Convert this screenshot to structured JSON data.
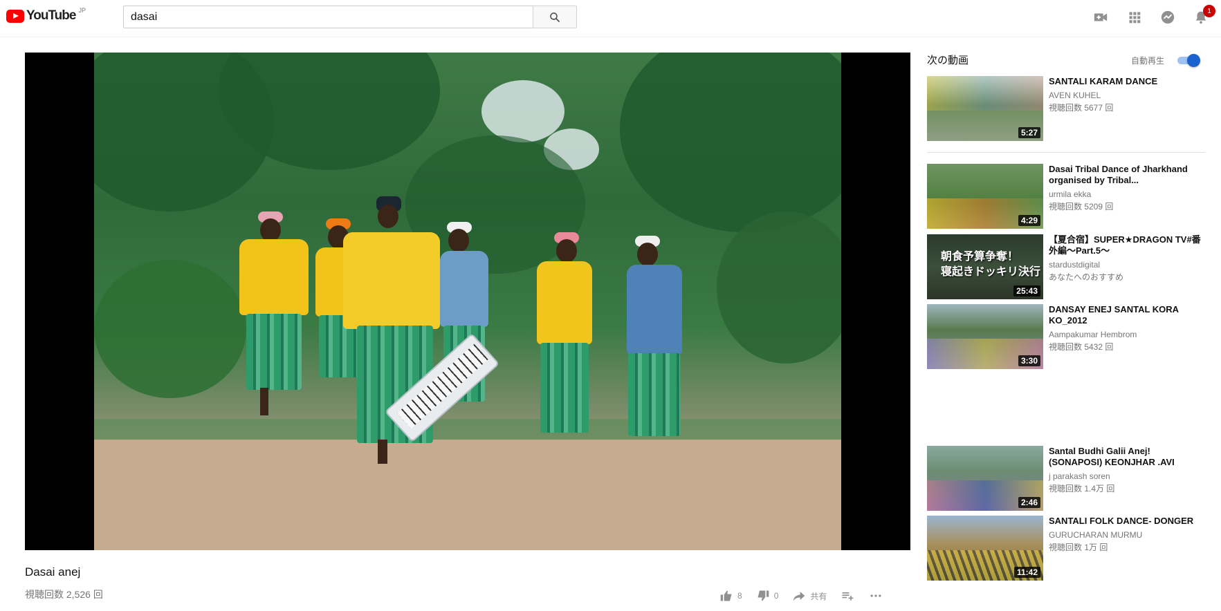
{
  "header": {
    "logo_text": "YouTube",
    "logo_region": "JP",
    "search_value": "dasai",
    "notification_count": "1",
    "icons": [
      "upload-video-icon",
      "apps-grid-icon",
      "messages-icon",
      "notifications-bell-icon"
    ]
  },
  "video": {
    "title": "Dasai anej",
    "view_count": "視聴回数 2,526 回",
    "likes": "8",
    "dislikes": "0",
    "share_label": "共有"
  },
  "sidebar": {
    "up_next_title": "次の動画",
    "autoplay_label": "自動再生",
    "autoplay_on": true,
    "items": [
      {
        "title": "SANTALI KARAM DANCE",
        "channel": "AVEN KUHEL",
        "views": "視聴回数 5677 回",
        "duration": "5:27"
      },
      {
        "title": "Dasai Tribal Dance of Jharkhand organised by Tribal...",
        "channel": "urmila ekka",
        "views": "視聴回数 5209 回",
        "duration": "4:29"
      },
      {
        "title": "【夏合宿】SUPER★DRAGON TV#番外編～Part.5～",
        "channel": "stardustdigital",
        "views": "あなたへのおすすめ",
        "duration": "25:43",
        "thumb_text_1": "朝食予算争奪！",
        "thumb_text_2": "寝起きドッキリ決行"
      },
      {
        "title": "DANSAY ENEJ SANTAL KORA KO_2012",
        "channel": "Aampakumar Hembrom",
        "views": "視聴回数 5432 回",
        "duration": "3:30"
      },
      {
        "title": "Santal Budhi Galii Anej! (SONAPOSI) KEONJHAR .AVI",
        "channel": "j parakash soren",
        "views": "視聴回数 1.4万 回",
        "duration": "2:46"
      },
      {
        "title": "SANTALI FOLK DANCE- DONGER",
        "channel": "GURUCHARAN MURMU",
        "views": "視聴回数 1万 回",
        "duration": "11:42"
      }
    ]
  },
  "colors": {
    "brand_red": "#ff0000",
    "toggle_blue": "#1a62d0",
    "badge_red": "#cc0000"
  }
}
